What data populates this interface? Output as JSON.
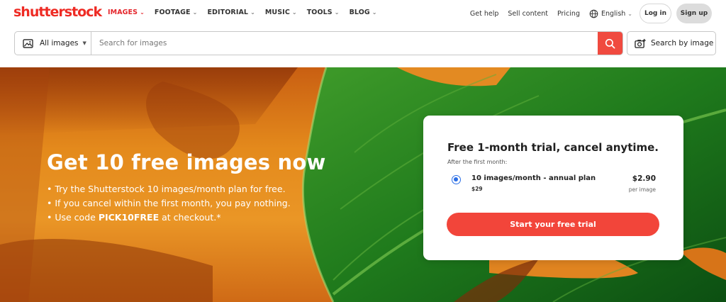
{
  "brand": {
    "logo_text": "shutterstock",
    "accent_color": "#ee2b24"
  },
  "nav": {
    "items": [
      {
        "label": "IMAGES",
        "active": true
      },
      {
        "label": "FOOTAGE",
        "active": false
      },
      {
        "label": "EDITORIAL",
        "active": false
      },
      {
        "label": "MUSIC",
        "active": false
      },
      {
        "label": "TOOLS",
        "active": false
      },
      {
        "label": "BLOG",
        "active": false
      }
    ],
    "chevron_icon": "chevron-down-icon",
    "get_help": "Get help",
    "sell_content": "Sell content",
    "pricing": "Pricing",
    "language": "English",
    "language_icon": "globe-icon",
    "login": "Log in",
    "signup": "Sign up"
  },
  "search": {
    "scope_label": "All images",
    "scope_icon": "image-icon",
    "placeholder": "Search for images",
    "value": "",
    "submit_icon": "search-icon",
    "search_by_image_label": "Search by image",
    "search_by_image_icon": "camera-icon"
  },
  "hero": {
    "title": "Get 10 free images now",
    "bullets": [
      {
        "text": "Try the Shutterstock 10 images/month plan for free."
      },
      {
        "text": "If you cancel within the first month, you pay nothing."
      },
      {
        "prefix": "Use code ",
        "code": "PICK10FREE",
        "suffix": " at checkout.*"
      }
    ]
  },
  "offer": {
    "title": "Free 1-month trial, cancel anytime.",
    "subtitle": "After the first month:",
    "plan": {
      "name": "10 images/month - annual plan",
      "total": "$29",
      "price": "$2.90",
      "price_unit": "per image",
      "selected": true
    },
    "cta": "Start your free trial",
    "cta_color": "#f2453a"
  }
}
